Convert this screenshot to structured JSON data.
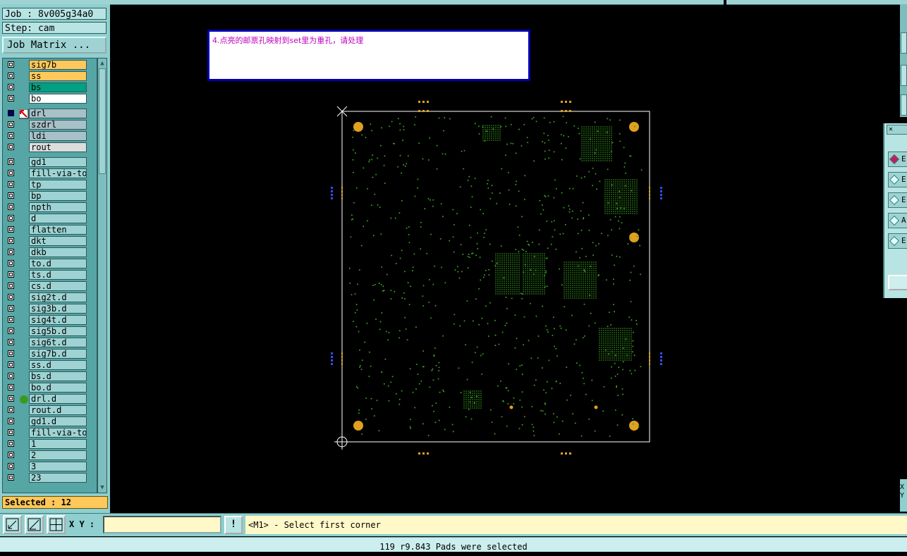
{
  "header": {
    "job_label": "Job : 8v005g34a0",
    "step_label": "Step: cam",
    "job_matrix_button": "Job Matrix ..."
  },
  "layers": [
    {
      "name": "sig7b",
      "color": "#ffc85a",
      "edit": ""
    },
    {
      "name": "ss",
      "color": "#ffc85a",
      "edit": ""
    },
    {
      "name": "bs",
      "color": "#00a080",
      "edit": ""
    },
    {
      "name": "bo",
      "color": "#ffffff",
      "edit": "✎"
    },
    {
      "name": "drl",
      "color": "#a8c0c8",
      "edit": "⊞",
      "active": true
    },
    {
      "name": "szdrl",
      "color": "#a8c0c8",
      "edit": ""
    },
    {
      "name": "ldi",
      "color": "#a8c0c8",
      "edit": ""
    },
    {
      "name": "rout",
      "color": "#dddddd",
      "edit": ""
    },
    {
      "name": "gd1",
      "color": "#9fd3d3",
      "edit": ""
    },
    {
      "name": "fill-via-top",
      "color": "#9fd3d3",
      "edit": ""
    },
    {
      "name": "tp",
      "color": "#9fd3d3",
      "edit": ""
    },
    {
      "name": "bp",
      "color": "#9fd3d3",
      "edit": ""
    },
    {
      "name": "npth",
      "color": "#9fd3d3",
      "edit": ""
    },
    {
      "name": "d",
      "color": "#9fd3d3",
      "edit": ""
    },
    {
      "name": "flatten",
      "color": "#9fd3d3",
      "edit": ""
    },
    {
      "name": "dkt",
      "color": "#9fd3d3",
      "edit": ""
    },
    {
      "name": "dkb",
      "color": "#9fd3d3",
      "edit": ""
    },
    {
      "name": "to.d",
      "color": "#9fd3d3",
      "edit": "✎"
    },
    {
      "name": "ts.d",
      "color": "#9fd3d3",
      "edit": ""
    },
    {
      "name": "cs.d",
      "color": "#9fd3d3",
      "edit": ""
    },
    {
      "name": "sig2t.d",
      "color": "#9fd3d3",
      "edit": ""
    },
    {
      "name": "sig3b.d",
      "color": "#9fd3d3",
      "edit": ""
    },
    {
      "name": "sig4t.d",
      "color": "#9fd3d3",
      "edit": ""
    },
    {
      "name": "sig5b.d",
      "color": "#9fd3d3",
      "edit": ""
    },
    {
      "name": "sig6t.d",
      "color": "#9fd3d3",
      "edit": ""
    },
    {
      "name": "sig7b.d",
      "color": "#9fd3d3",
      "edit": ""
    },
    {
      "name": "ss.d",
      "color": "#9fd3d3",
      "edit": ""
    },
    {
      "name": "bs.d",
      "color": "#9fd3d3",
      "edit": ""
    },
    {
      "name": "bo.d",
      "color": "#9fd3d3",
      "edit": "✎"
    },
    {
      "name": "drl.d",
      "color": "#9fd3d3",
      "edit": "",
      "dot": "#3a9a20"
    },
    {
      "name": "rout.d",
      "color": "#9fd3d3",
      "edit": ""
    },
    {
      "name": "gd1.d",
      "color": "#9fd3d3",
      "edit": ""
    },
    {
      "name": "fill-via-top",
      "color": "#9fd3d3",
      "edit": ""
    },
    {
      "name": "1",
      "color": "#9fd3d3",
      "edit": ""
    },
    {
      "name": "2",
      "color": "#9fd3d3",
      "edit": ""
    },
    {
      "name": "3",
      "color": "#9fd3d3",
      "edit": ""
    },
    {
      "name": "23",
      "color": "#9fd3d3",
      "edit": ""
    }
  ],
  "selected_status": "Selected : 12",
  "message": "4.点亮的邮票孔映射到set里为重孔，请处理",
  "toolbar": {
    "xy_label": "X Y :",
    "xy_value": "",
    "excl_label": "!",
    "prompt": "<M1> - Select first corner"
  },
  "status_line": "119 r9.843 Pads were selected",
  "right_panel": {
    "items": [
      "E",
      "E",
      "E",
      "A",
      "E"
    ]
  },
  "right_bottom_strip": [
    "X",
    "Y"
  ],
  "icons": {
    "edit": "pencil-icon",
    "active_marker": "cursor-icon",
    "tool1": "zoom-box-icon",
    "tool2": "measure-icon",
    "tool3": "grid-snap-icon"
  },
  "colors": {
    "panel": "#8fcfcf",
    "board_outline": "#ffffff",
    "pad_orange": "#e0a020",
    "via_green": "#3aa020",
    "fiducial_blue": "#3050ff",
    "message_text": "#c000c0"
  }
}
